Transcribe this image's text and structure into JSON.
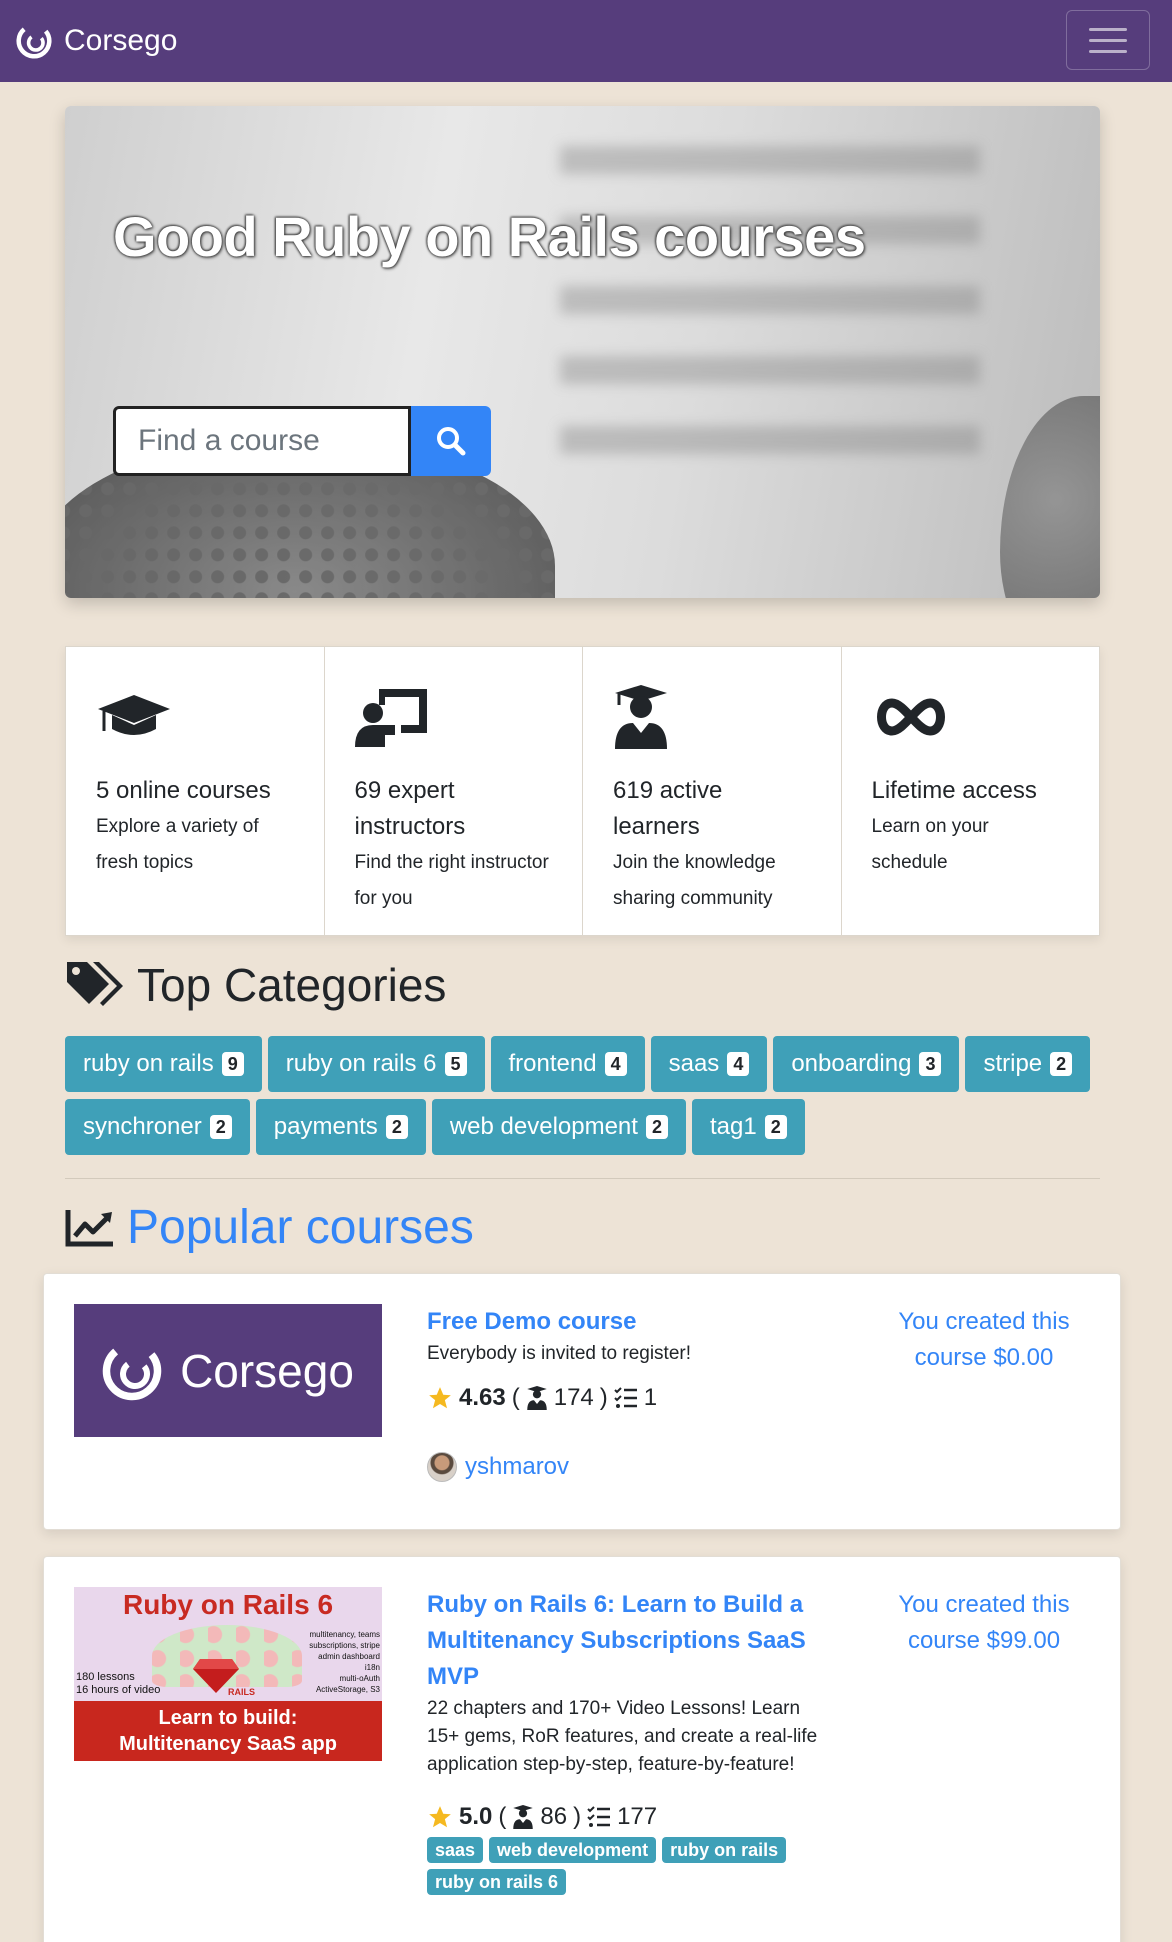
{
  "navbar": {
    "brand": "Corsego",
    "toggle_icon": "hamburger-icon"
  },
  "hero": {
    "title": "Good Ruby on Rails courses",
    "search_placeholder": "Find a course",
    "search_icon": "search-icon"
  },
  "features": [
    {
      "icon": "graduation-cap-icon",
      "title": "5 online courses",
      "desc": "Explore a variety of fresh topics"
    },
    {
      "icon": "chalkboard-teacher-icon",
      "title": "69 expert instructors",
      "desc": "Find the right instructor for you"
    },
    {
      "icon": "user-graduate-icon",
      "title": "619 active learners",
      "desc": "Join the knowledge sharing community"
    },
    {
      "icon": "infinity-icon",
      "title": "Lifetime access",
      "desc": "Learn on your schedule"
    }
  ],
  "categories": {
    "heading": "Top Categories",
    "tags": [
      {
        "label": "ruby on rails",
        "count": "9"
      },
      {
        "label": "ruby on rails 6",
        "count": "5"
      },
      {
        "label": "frontend",
        "count": "4"
      },
      {
        "label": "saas",
        "count": "4"
      },
      {
        "label": "onboarding",
        "count": "3"
      },
      {
        "label": "stripe",
        "count": "2"
      },
      {
        "label": "synchroner",
        "count": "2"
      },
      {
        "label": "payments",
        "count": "2"
      },
      {
        "label": "web development",
        "count": "2"
      },
      {
        "label": "tag1",
        "count": "2"
      }
    ]
  },
  "popular": {
    "heading": "Popular courses",
    "courses": [
      {
        "thumb_text": "Corsego",
        "title": "Free Demo course",
        "desc": "Everybody is invited to register!",
        "rating": "4.63",
        "students": "174",
        "lessons": "1",
        "author": "yshmarov",
        "price_line1": "You created this",
        "price_line2": "course $0.00"
      },
      {
        "thumb_title": "Ruby on Rails 6",
        "thumb_left1": "180 lessons",
        "thumb_left2": "16 hours of video",
        "thumb_right": [
          "multitenancy, teams",
          "subscriptions, stripe",
          "admin dashboard",
          "i18n",
          "multi-oAuth",
          "ActiveStorage, S3"
        ],
        "thumb_rails": "RAILS",
        "thumb_banner1": "Learn to build:",
        "thumb_banner2": "Multitenancy SaaS app",
        "title": "Ruby on Rails 6: Learn to Build a Multitenancy Subscriptions SaaS MVP",
        "desc": "22 chapters and 170+ Video Lessons! Learn 15+ gems, RoR features, and create a real-life application step-by-step, feature-by-feature!",
        "rating": "5.0",
        "students": "86",
        "lessons": "177",
        "price_line1": "You created this",
        "price_line2": "course $99.00",
        "tags": [
          "saas",
          "web development",
          "ruby on rails",
          "ruby on rails 6"
        ]
      }
    ]
  }
}
